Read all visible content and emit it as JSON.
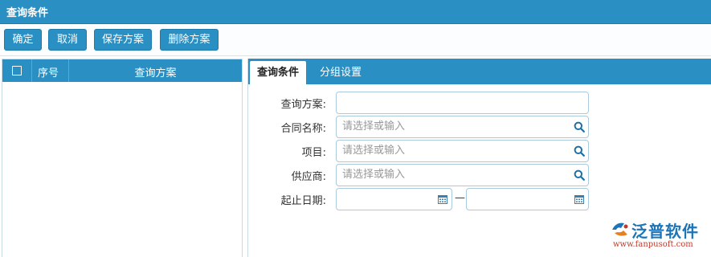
{
  "window": {
    "title": "查询条件"
  },
  "toolbar": {
    "confirm_label": "确定",
    "cancel_label": "取消",
    "save_plan_label": "保存方案",
    "delete_plan_label": "删除方案"
  },
  "plan_list": {
    "columns": {
      "no": "序号",
      "plan": "查询方案"
    },
    "rows": []
  },
  "tabs": {
    "conditions": "查询条件",
    "grouping": "分组设置"
  },
  "form": {
    "plan": {
      "label": "查询方案:",
      "value": ""
    },
    "contract_name": {
      "label": "合同名称:",
      "placeholder": "请选择或输入"
    },
    "project": {
      "label": "项目:",
      "placeholder": "请选择或输入"
    },
    "supplier": {
      "label": "供应商:",
      "placeholder": "请选择或输入"
    },
    "date_range": {
      "label": "起止日期:",
      "separator": "—",
      "start": "",
      "end": ""
    }
  },
  "brand": {
    "name": "泛普软件",
    "url": "www.fanpusoft.com"
  },
  "colors": {
    "primary": "#2a8fc3",
    "border": "#a9c9de",
    "brand_blue": "#1d74b6",
    "brand_red": "#c0392b"
  },
  "icons": {
    "search": "search-icon",
    "calendar": "calendar-icon",
    "checkbox": "checkbox-icon",
    "logo": "fanpu-logo-icon"
  }
}
